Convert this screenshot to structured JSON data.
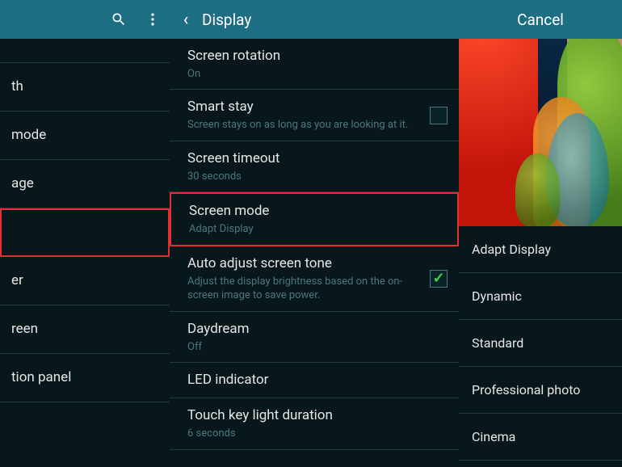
{
  "left": {
    "items": [
      {
        "label": "th"
      },
      {
        "label": "mode"
      },
      {
        "label": "age"
      },
      {
        "label": ""
      },
      {
        "label": "er"
      },
      {
        "label": "reen"
      },
      {
        "label": "tion panel"
      }
    ]
  },
  "mid": {
    "title": "Display",
    "items": [
      {
        "label": "Screen rotation",
        "sub": "On"
      },
      {
        "label": "Smart stay",
        "sub": "Screen stays on as long as you are looking at it.",
        "checkbox": true,
        "checked": false
      },
      {
        "label": "Screen timeout",
        "sub": "30 seconds"
      },
      {
        "label": "Screen mode",
        "sub": "Adapt Display",
        "highlight": true
      },
      {
        "label": "Auto adjust screen tone",
        "sub": "Adjust the display brightness based on the on-screen image to save power.",
        "checkbox": true,
        "checked": true
      },
      {
        "label": "Daydream",
        "sub": "Off"
      },
      {
        "label": "LED indicator"
      },
      {
        "label": "Touch key light duration",
        "sub": "6 seconds"
      }
    ]
  },
  "right": {
    "cancel": "Cancel",
    "options": [
      "Adapt Display",
      "Dynamic",
      "Standard",
      "Professional photo",
      "Cinema"
    ]
  }
}
